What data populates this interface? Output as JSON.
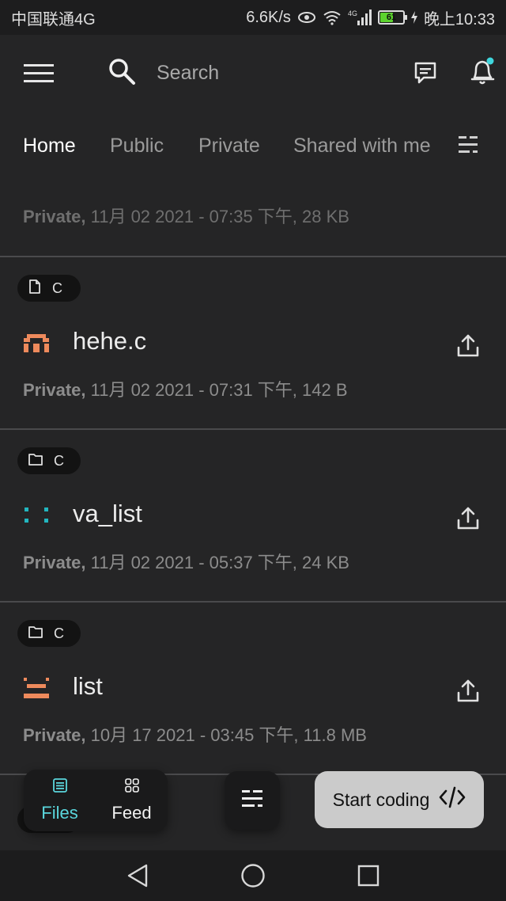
{
  "status_bar": {
    "carrier": "中国联通4G",
    "speed": "6.6K/s",
    "network_label": "4G",
    "battery": "61",
    "battery_level": 0.61,
    "time": "晚上10:33"
  },
  "app_bar": {
    "search_placeholder": "Search",
    "notification_dot_color": "#3fd6dd"
  },
  "tabs": [
    {
      "label": "Home",
      "active": true
    },
    {
      "label": "Public",
      "active": false
    },
    {
      "label": "Private",
      "active": false
    },
    {
      "label": "Shared with me",
      "active": false
    }
  ],
  "partial_item": {
    "visibility": "Private,",
    "details": " 11月 02 2021 - 07:35 下午,  28 KB"
  },
  "files": [
    {
      "language": "C",
      "name": "hehe.c",
      "icon": "orange-arch-icon",
      "visibility": "Private,",
      "details": " 11月 02 2021 - 07:31 下午,  142 B"
    },
    {
      "language": "C",
      "name": "va_list",
      "icon": "teal-dots-icon",
      "visibility": "Private,",
      "details": " 11月 02 2021 - 05:37 下午,  24 KB"
    },
    {
      "language": "C",
      "name": "list",
      "icon": "orange-bars-icon",
      "visibility": "Private,",
      "details": " 10月 17 2021 - 03:45 下午,  11.8 MB"
    }
  ],
  "bottom_nav": {
    "files_label": "Files",
    "feed_label": "Feed",
    "start_coding_label": "Start coding",
    "accent_color": "#5ad6dc"
  }
}
